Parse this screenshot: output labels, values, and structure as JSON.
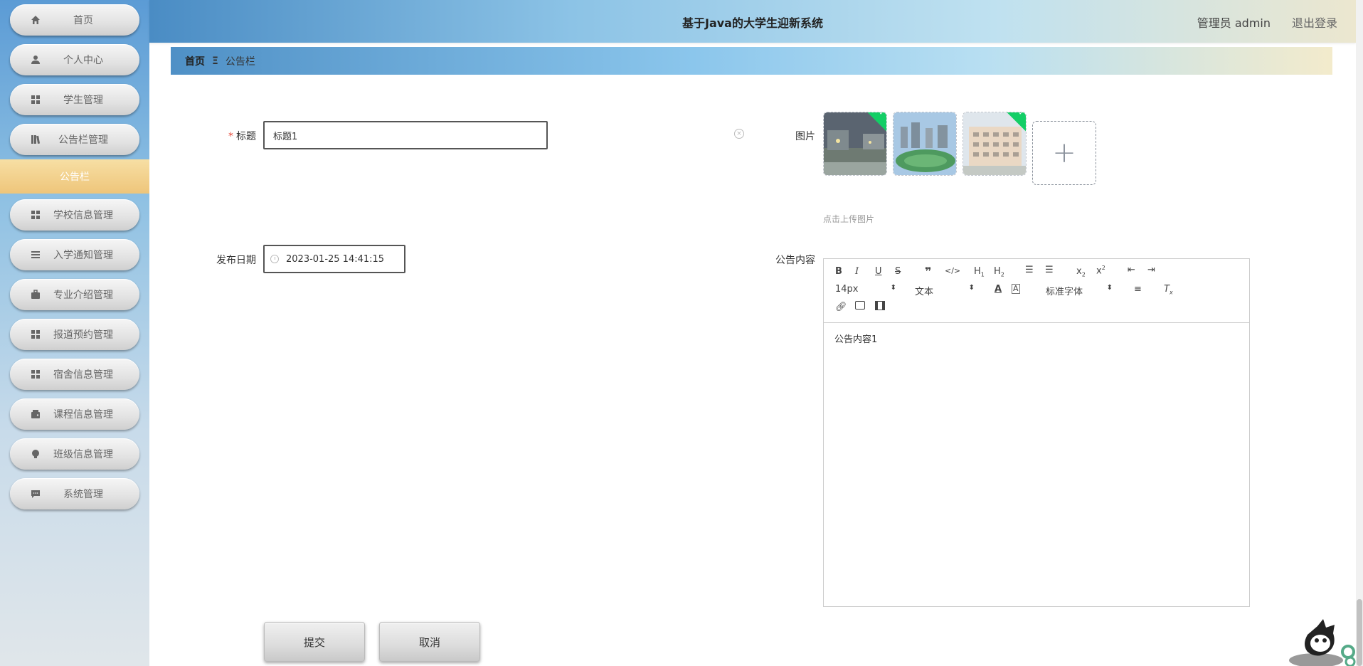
{
  "app": {
    "title": "基于Java的大学生迎新系统"
  },
  "header": {
    "user": "管理员 admin",
    "logout": "退出登录"
  },
  "sidebar": {
    "items": [
      {
        "label": "首页",
        "icon": "home-icon"
      },
      {
        "label": "个人中心",
        "icon": "user-icon"
      },
      {
        "label": "学生管理",
        "icon": "grid-icon"
      },
      {
        "label": "公告栏管理",
        "icon": "book-icon"
      },
      {
        "label": "学校信息管理",
        "icon": "grid-icon"
      },
      {
        "label": "入学通知管理",
        "icon": "list-icon"
      },
      {
        "label": "专业介绍管理",
        "icon": "briefcase-icon"
      },
      {
        "label": "报道预约管理",
        "icon": "grid-icon"
      },
      {
        "label": "宿舍信息管理",
        "icon": "grid-icon"
      },
      {
        "label": "课程信息管理",
        "icon": "wallet-icon"
      },
      {
        "label": "班级信息管理",
        "icon": "bulb-icon"
      },
      {
        "label": "系统管理",
        "icon": "chat-icon"
      }
    ],
    "active_sub": "公告栏"
  },
  "breadcrumb": {
    "home": "首页",
    "separator": "Ξ",
    "current": "公告栏"
  },
  "form": {
    "title_label": "标题",
    "title_value": "标题1",
    "image_label": "图片",
    "upload_tip": "点击上传图片",
    "date_label": "发布日期",
    "date_value": "2023-01-25 14:41:15",
    "content_label": "公告内容",
    "content_value": "公告内容1",
    "submit": "提交",
    "cancel": "取消"
  },
  "editor": {
    "font_size": "14px",
    "block_format": "文本",
    "font_family": "标准字体"
  },
  "colors": {
    "accent": "#eec57a",
    "required": "#e74c3c",
    "success": "#13ce66"
  }
}
